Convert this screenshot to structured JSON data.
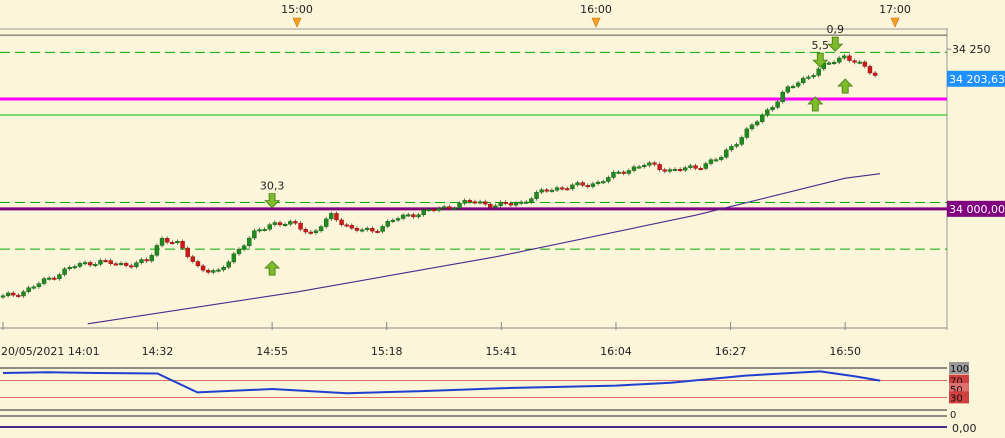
{
  "chart_data": {
    "type": "candlestick",
    "date_label": "20/05/2021 14:01",
    "time_axis": {
      "bottom_ticks": [
        "20/05/2021 14:01",
        "14:32",
        "14:55",
        "15:18",
        "15:41",
        "16:04",
        "16:27",
        "16:50"
      ],
      "top_ticks": [
        "15:00",
        "16:00",
        "17:00"
      ]
    },
    "price_axis": {
      "ticks": [
        "34 250"
      ],
      "ylim": [
        33815,
        34280
      ]
    },
    "last_price_label": "34 203,63",
    "level_label": "34 000,00",
    "price_series": [
      {
        "t": "14:01",
        "p": 33862
      },
      {
        "t": "14:05",
        "p": 33870
      },
      {
        "t": "14:10",
        "p": 33890
      },
      {
        "t": "14:15",
        "p": 33910
      },
      {
        "t": "14:20",
        "p": 33918
      },
      {
        "t": "14:25",
        "p": 33912
      },
      {
        "t": "14:30",
        "p": 33918
      },
      {
        "t": "14:33",
        "p": 33955
      },
      {
        "t": "14:36",
        "p": 33945
      },
      {
        "t": "14:40",
        "p": 33910
      },
      {
        "t": "14:44",
        "p": 33898
      },
      {
        "t": "14:48",
        "p": 33935
      },
      {
        "t": "14:52",
        "p": 33965
      },
      {
        "t": "14:55",
        "p": 33978
      },
      {
        "t": "15:00",
        "p": 33975
      },
      {
        "t": "15:03",
        "p": 33960
      },
      {
        "t": "15:07",
        "p": 33990
      },
      {
        "t": "15:11",
        "p": 33968
      },
      {
        "t": "15:15",
        "p": 33965
      },
      {
        "t": "15:20",
        "p": 33985
      },
      {
        "t": "15:25",
        "p": 33995
      },
      {
        "t": "15:30",
        "p": 34002
      },
      {
        "t": "15:35",
        "p": 34012
      },
      {
        "t": "15:40",
        "p": 34005
      },
      {
        "t": "15:45",
        "p": 34010
      },
      {
        "t": "15:50",
        "p": 34030
      },
      {
        "t": "15:55",
        "p": 34035
      },
      {
        "t": "16:00",
        "p": 34040
      },
      {
        "t": "16:05",
        "p": 34058
      },
      {
        "t": "16:10",
        "p": 34070
      },
      {
        "t": "16:15",
        "p": 34060
      },
      {
        "t": "16:20",
        "p": 34065
      },
      {
        "t": "16:25",
        "p": 34080
      },
      {
        "t": "16:30",
        "p": 34120
      },
      {
        "t": "16:34",
        "p": 34150
      },
      {
        "t": "16:38",
        "p": 34185
      },
      {
        "t": "16:42",
        "p": 34205
      },
      {
        "t": "16:46",
        "p": 34225
      },
      {
        "t": "16:50",
        "p": 34240
      },
      {
        "t": "16:53",
        "p": 34225
      },
      {
        "t": "16:56",
        "p": 34210
      }
    ],
    "moving_average": [
      {
        "t": "14:18",
        "p": 33820
      },
      {
        "t": "15:00",
        "p": 33870
      },
      {
        "t": "15:40",
        "p": 33925
      },
      {
        "t": "16:20",
        "p": 33990
      },
      {
        "t": "16:50",
        "p": 34048
      },
      {
        "t": "16:57",
        "p": 34055
      }
    ],
    "horizontal_levels": [
      {
        "price": 34272,
        "color": "#555555",
        "style": "solid"
      },
      {
        "price": 34245,
        "color": "#00aa00",
        "style": "dashed"
      },
      {
        "price": 34172,
        "color": "#ff00ff",
        "style": "solid"
      },
      {
        "price": 34147,
        "color": "#00bb00",
        "style": "solid"
      },
      {
        "price": 34010,
        "color": "#00aa00",
        "style": "dashed"
      },
      {
        "price": 34000,
        "color": "#800080",
        "style": "solid"
      },
      {
        "price": 33937,
        "color": "#00aa00",
        "style": "dashed"
      }
    ],
    "annotations": [
      {
        "label": "30,3",
        "t": "14:55",
        "p": 34005,
        "arrow": "down"
      },
      {
        "label": "",
        "t": "14:55",
        "p": 33915,
        "arrow": "up"
      },
      {
        "label": "5,5",
        "t": "16:45",
        "p": 34225,
        "arrow": "down"
      },
      {
        "label": "",
        "t": "16:44",
        "p": 34172,
        "arrow": "up"
      },
      {
        "label": "",
        "t": "16:50",
        "p": 34200,
        "arrow": "up"
      },
      {
        "label": "0,9",
        "t": "16:48",
        "p": 34250,
        "arrow": "down"
      }
    ],
    "rsi_panel": {
      "ticks": [
        "100",
        "70",
        "50",
        "30"
      ],
      "ylim": [
        0,
        100
      ],
      "levels": [
        70,
        30
      ],
      "series": [
        {
          "t": "14:01",
          "v": 88
        },
        {
          "t": "14:10",
          "v": 90
        },
        {
          "t": "14:20",
          "v": 88
        },
        {
          "t": "14:32",
          "v": 87
        },
        {
          "t": "14:40",
          "v": 42
        },
        {
          "t": "14:55",
          "v": 50
        },
        {
          "t": "15:10",
          "v": 40
        },
        {
          "t": "15:25",
          "v": 45
        },
        {
          "t": "15:41",
          "v": 52
        },
        {
          "t": "16:04",
          "v": 58
        },
        {
          "t": "16:15",
          "v": 65
        },
        {
          "t": "16:30",
          "v": 82
        },
        {
          "t": "16:45",
          "v": 92
        },
        {
          "t": "16:52",
          "v": 80
        },
        {
          "t": "16:57",
          "v": 70
        }
      ]
    },
    "volume_panel": {
      "ticks": [
        "0",
        "0,00"
      ]
    }
  }
}
